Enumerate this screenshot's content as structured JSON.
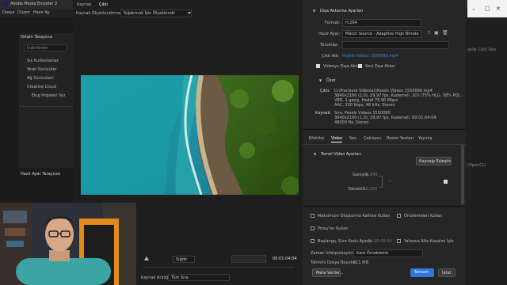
{
  "app": {
    "title": "Adobe Media Encoder 2",
    "menu": [
      "Dosya",
      "Düzen",
      "Hazır Ay"
    ]
  },
  "left_panel": {
    "title": "Ortam Tarayıcısı",
    "dropdown": "İndirilenler",
    "items": [
      "Sık Kullanılanlar",
      "Yerel Sürücüler",
      "Ağ Sürücüleri",
      "Creative Cloud",
      "Ekip Projeleri Sür"
    ],
    "preset_title": "Hazır Ayar Tarayıcısı"
  },
  "right_bg": {
    "text": "anlık Ciklt Sesı",
    "opencl": "(OpenCL)"
  },
  "preview": {
    "tabs": [
      "Kaynak",
      "Çıktı"
    ],
    "source_scaling_label": "Kaynak Ölçeklendirme:",
    "source_scaling_value": "Sığdırmak İçin Ölçeklendir",
    "fit_value": "Sığdır",
    "timecode": "00:01:04:04",
    "source_range_label": "Kaynak Aralığı:",
    "source_range_value": "Tüm Sıra"
  },
  "export": {
    "section_title": "Dışa Aktarma Ayarları",
    "format_label": "Format:",
    "format_value": "H.264",
    "preset_label": "Hazır Ayar:",
    "preset_value": "Match Source - Adaptive High Bitrate",
    "comments_label": "Yorumlar:",
    "output_label": "Çıktı Adı:",
    "output_value": "Pexels Videos 1550080.mp4",
    "export_video_label": "Videoyu Dışa Aktar",
    "export_audio_label": "Sesi Dışa Aktar",
    "summary_title": "Özet",
    "output_key": "Çıktı:",
    "output_lines": [
      "D:\\Premiere Videolar\\Pexels Videos 1550080.mp4",
      "3840x2160 (1,0), 29,97 fps, Kademeli, 2D) (75% HLG, 58% PQ)...",
      "VBR, 1 geçiş, Hedef 75,90 Mbps",
      "AAC, 320 kbps, 48 kHz, Stereo"
    ],
    "source_key": "Kaynak:",
    "source_lines": [
      "Sıra, Pexels Videos 1550080",
      "3840x2160 (1,0), 29,97 fps, Kademeli, 00:01:04:04",
      "48000 Hz, Stereo"
    ]
  },
  "tabs": [
    "Efektler",
    "Video",
    "Ses",
    "Çoklayıcı",
    "Resim Yazıları",
    "Yayınla"
  ],
  "video": {
    "section_title": "Temel Video Ayarları",
    "match_source_button": "Kaynağı Eşleştir",
    "width_label": "Genişlik:",
    "width_value": "3.840",
    "height_label": "Yükseklik:",
    "height_value": "2.160"
  },
  "bottom": {
    "max_render_label": "Maksimum Oluşturma Kalitesi Kullan",
    "previews_label": "Önizlemeleri Kullan",
    "proxy_label": "Proxy'ler Kullan",
    "start_tc_label": "Başlangıç Süre Kodu Ayarla",
    "start_tc_value": "00:00:00:00",
    "alpha_label": "Yalnızca Alfa Kanalını İşle",
    "interp_label": "Zaman İnterpolasyonu:",
    "interp_value": "Kare Örnekleme",
    "filesize_label": "Tahmini Dosya Boyutu:",
    "filesize_value": "611 MB",
    "metadata_button": "Meta Veriler...",
    "ok_button": "Tamam",
    "cancel_button": "İptal"
  },
  "colors": {
    "accent": "#2d77e0",
    "link": "#2f8fe8",
    "shirt": "#3aa5a2"
  }
}
